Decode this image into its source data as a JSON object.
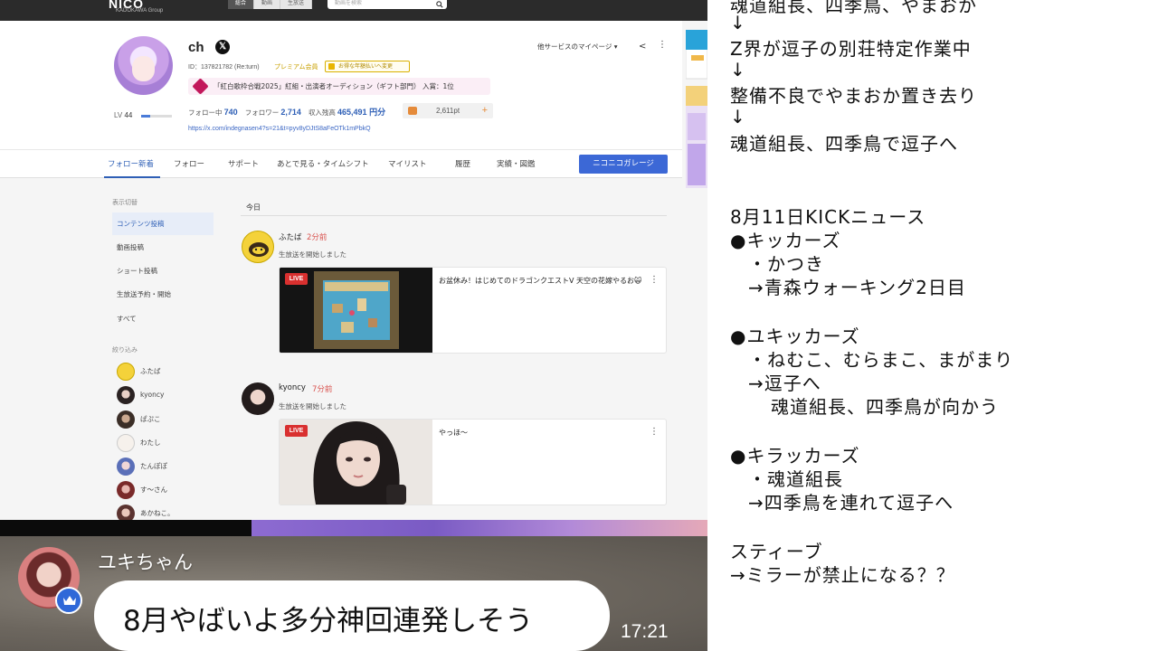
{
  "browser": {
    "logo": "NICO",
    "logo_sub": "KADOKAWA Group",
    "search_tabs": [
      "総合",
      "動画",
      "生放送"
    ],
    "search_placeholder": "動画を検索",
    "profile": {
      "name": "ch",
      "id_line": "ID：137821782 (Re:turn)",
      "premium": "プレミアム会員",
      "plan_button": "お得な年額払いへ変更",
      "award": "「紅白歌枠合戦2025」紅組・出演者オーディション（ギフト部門） 入賞：1位",
      "following_label": "フォロー中",
      "following": "740",
      "followers_label": "フォロワー",
      "followers": "2,714",
      "revenue_label": "収入残高",
      "revenue": "465,491 円分",
      "points": "2,611pt",
      "points_plus": "+",
      "link": "https://x.com/indegnasen4?s=21&t=pyv8yDJtS8aFeOTk1mPbkQ",
      "level_label": "LV",
      "level": "44",
      "other_services": "他サービスのマイページ ▾"
    },
    "tabs": [
      {
        "label": "フォロー新着",
        "active": true
      },
      {
        "label": "フォロー"
      },
      {
        "label": "サポート"
      },
      {
        "label": "あとで見る・タイムシフト"
      },
      {
        "label": "マイリスト"
      },
      {
        "label": "履歴"
      },
      {
        "label": "実績・図鑑"
      }
    ],
    "garage_button": "ニコニコガレージ",
    "sidebar": {
      "display_label": "表示切替",
      "items": [
        "コンテンツ投稿",
        "動画投稿",
        "ショート投稿",
        "生放送予約・開始",
        "すべて"
      ],
      "filter_label": "絞り込み",
      "filters": [
        "ふたば",
        "kyoncy",
        "ぱぷこ",
        "わたし",
        "たんぽぽ",
        "す〜さん",
        "あかねこ。"
      ]
    },
    "feed": {
      "today_label": "今日",
      "items": [
        {
          "name": "ふたば",
          "time": "2分前",
          "action": "生放送を開始しました",
          "live": "LIVE",
          "title": "お盆休み！はじめてのドラゴンクエストⅤ 天空の花嫁やるお🙀"
        },
        {
          "name": "kyoncy",
          "time": "7分前",
          "action": "生放送を開始しました",
          "live": "LIVE",
          "title": "やっほ〜"
        }
      ]
    }
  },
  "cam": {
    "name": "ユキちゃん",
    "message": "8月やばいよ多分神回連発しそう",
    "time": "17:21"
  },
  "notes": {
    "lines": [
      "魂道組長、四季鳥、やまおか",
      "↓",
      "Z界が逗子の別荘特定作業中",
      "↓",
      "整備不良でやまおか置き去り",
      "↓",
      "魂道組長、四季鳥で逗子へ",
      "8月11日KICKニュース",
      "●キッカーズ",
      "・かつき",
      "→青森ウォーキング2日目",
      "●ユキッカーズ",
      "・ねむこ、むらまこ、まがまり",
      "→逗子へ",
      "魂道組長、四季鳥が向かう",
      "●キラッカーズ",
      "・魂道組長",
      "→四季鳥を連れて逗子へ",
      "スティーブ",
      "→ミラーが禁止になる？？"
    ]
  },
  "colors": {
    "accent_blue": "#2e5fb6",
    "live_red": "#d9302f",
    "garage_blue": "#3c68d6",
    "crown_blue": "#2f68d8"
  }
}
